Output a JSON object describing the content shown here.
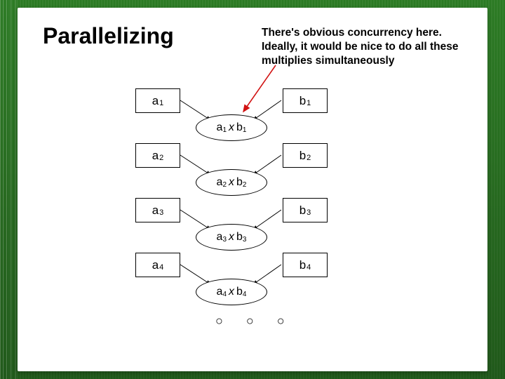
{
  "title": "Parallelizing",
  "note": "There's obvious concurrency here. Ideally, it would be nice to do all these multiplies simultaneously",
  "rows": [
    {
      "a": "a",
      "ai": "1",
      "b": "b",
      "bi": "1",
      "op_l": "a",
      "op_li": "1",
      "x": "x",
      "op_r": "b",
      "op_ri": "1"
    },
    {
      "a": "a",
      "ai": "2",
      "b": "b",
      "bi": "2",
      "op_l": "a",
      "op_li": "2",
      "x": "x",
      "op_r": "b",
      "op_ri": "2"
    },
    {
      "a": "a",
      "ai": "3",
      "b": "b",
      "bi": "3",
      "op_l": "a",
      "op_li": "3",
      "x": "x",
      "op_r": "b",
      "op_ri": "3"
    },
    {
      "a": "a",
      "ai": "4",
      "b": "b",
      "bi": "4",
      "op_l": "a",
      "op_li": "4",
      "x": "x",
      "op_r": "b",
      "op_ri": "4"
    }
  ],
  "dots": "○ ○ ○",
  "arrow_color": "#d11313"
}
